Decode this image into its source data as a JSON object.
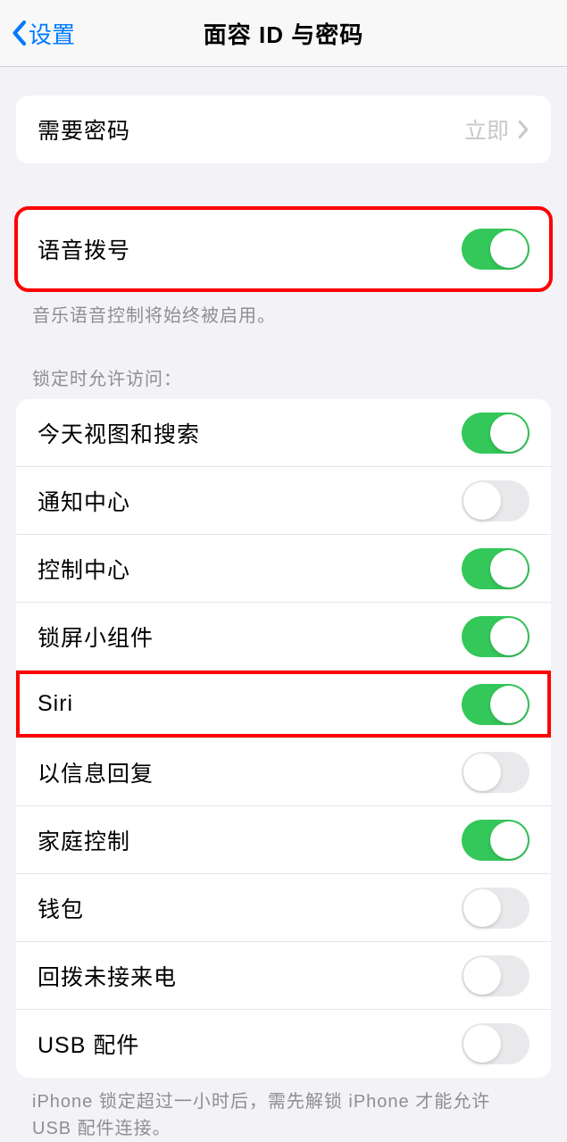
{
  "navbar": {
    "back_label": "设置",
    "title": "面容 ID 与密码"
  },
  "require_passcode": {
    "label": "需要密码",
    "value": "立即"
  },
  "voice_dial": {
    "label": "语音拨号",
    "footer": "音乐语音控制将始终被启用。",
    "on": true
  },
  "lock_access": {
    "header": "锁定时允许访问：",
    "items": [
      {
        "label": "今天视图和搜索",
        "on": true
      },
      {
        "label": "通知中心",
        "on": false
      },
      {
        "label": "控制中心",
        "on": true
      },
      {
        "label": "锁屏小组件",
        "on": true
      },
      {
        "label": "Siri",
        "on": true,
        "highlight": true
      },
      {
        "label": "以信息回复",
        "on": false
      },
      {
        "label": "家庭控制",
        "on": true
      },
      {
        "label": "钱包",
        "on": false
      },
      {
        "label": "回拨未接来电",
        "on": false
      },
      {
        "label": "USB 配件",
        "on": false
      }
    ],
    "footer": "iPhone 锁定超过一小时后，需先解锁 iPhone 才能允许 USB 配件连接。"
  }
}
